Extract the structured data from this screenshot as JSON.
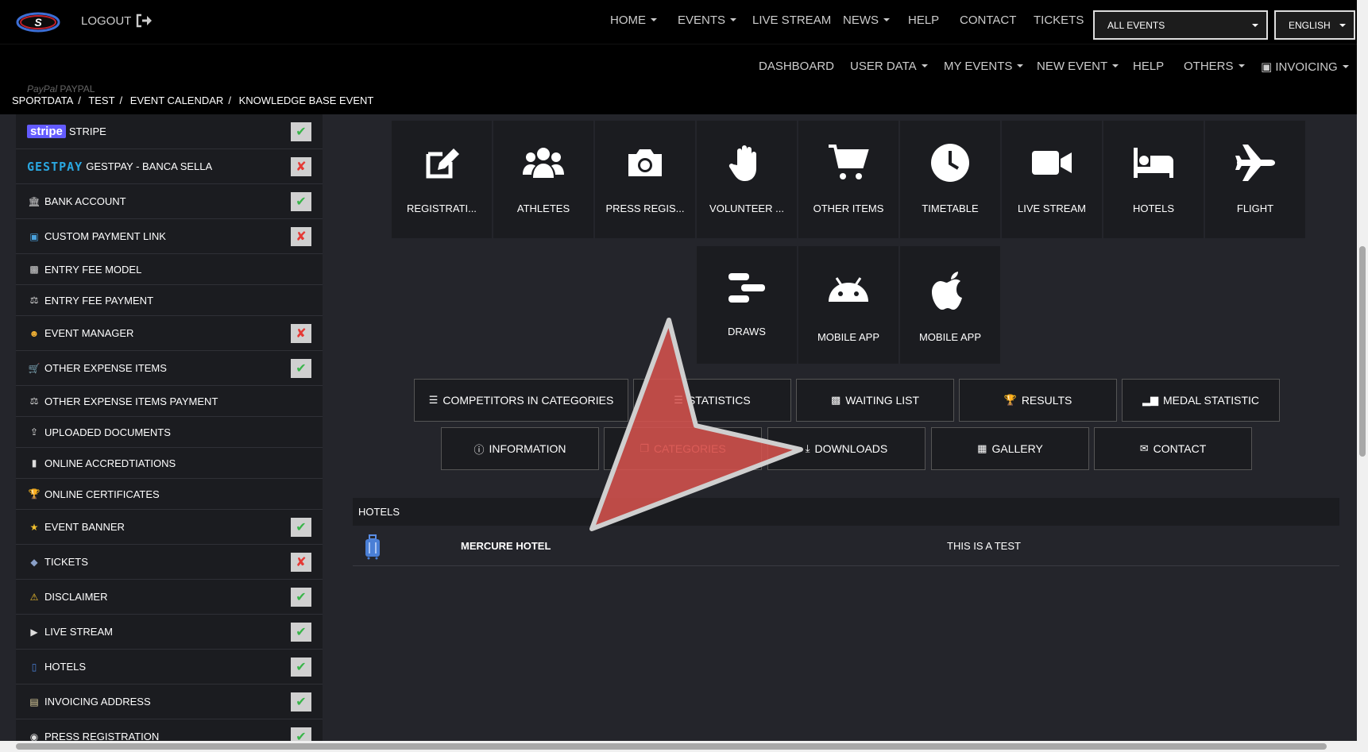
{
  "header": {
    "logout": "LOGOUT",
    "nav": [
      {
        "label": "HOME",
        "dropdown": true
      },
      {
        "label": "EVENTS",
        "dropdown": true
      },
      {
        "label": "LIVE STREAM",
        "dropdown": false
      },
      {
        "label": "NEWS",
        "dropdown": true
      },
      {
        "label": "HELP",
        "dropdown": false
      },
      {
        "label": "CONTACT",
        "dropdown": false
      },
      {
        "label": "TICKETS",
        "dropdown": false
      }
    ],
    "event_select": "ALL EVENTS",
    "language_select": "ENGLISH"
  },
  "subnav": [
    {
      "label": "DASHBOARD",
      "dropdown": false
    },
    {
      "label": "USER DATA",
      "dropdown": true
    },
    {
      "label": "MY EVENTS",
      "dropdown": true
    },
    {
      "label": "NEW EVENT",
      "dropdown": true
    },
    {
      "label": "HELP",
      "dropdown": false
    },
    {
      "label": "OTHERS",
      "dropdown": true
    },
    {
      "label": "INVOICING",
      "dropdown": true
    }
  ],
  "breadcrumb": [
    "SPORTDATA",
    "TEST",
    "EVENT CALENDAR",
    "KNOWLEDGE BASE EVENT"
  ],
  "ghost_row": {
    "logo": "PayPal",
    "label": "PAYPAL"
  },
  "sidebar": {
    "stripe_logo": "stripe",
    "gestpay_logo": "GESTPAY",
    "items": [
      {
        "label": "STRIPE",
        "status": "ok",
        "icon": "stripe-logo"
      },
      {
        "label": "GESTPAY - BANCA SELLA",
        "status": "no",
        "icon": "gestpay-logo"
      },
      {
        "label": "BANK ACCOUNT",
        "status": "ok",
        "icon": "bank-icon"
      },
      {
        "label": "CUSTOM PAYMENT LINK",
        "status": "no",
        "icon": "card-icon"
      },
      {
        "label": "ENTRY FEE MODEL",
        "status": "",
        "icon": "money-icon"
      },
      {
        "label": "ENTRY FEE PAYMENT",
        "status": "",
        "icon": "payment-icon"
      },
      {
        "label": "EVENT MANAGER",
        "status": "no",
        "icon": "user-icon"
      },
      {
        "label": "OTHER EXPENSE ITEMS",
        "status": "ok",
        "icon": "cart-icon"
      },
      {
        "label": "OTHER EXPENSE ITEMS PAYMENT",
        "status": "",
        "icon": "payment-icon"
      },
      {
        "label": "UPLOADED DOCUMENTS",
        "status": "",
        "icon": "upload-icon"
      },
      {
        "label": "ONLINE ACCREDTIATIONS",
        "status": "",
        "icon": "badge-icon"
      },
      {
        "label": "ONLINE CERTIFICATES",
        "status": "",
        "icon": "trophy-icon"
      },
      {
        "label": "EVENT BANNER",
        "status": "ok",
        "icon": "star-icon"
      },
      {
        "label": "TICKETS",
        "status": "no",
        "icon": "ticket-icon"
      },
      {
        "label": "DISCLAIMER",
        "status": "ok",
        "icon": "warning-icon"
      },
      {
        "label": "LIVE STREAM",
        "status": "ok",
        "icon": "video-icon"
      },
      {
        "label": "HOTELS",
        "status": "ok",
        "icon": "luggage-icon"
      },
      {
        "label": "INVOICING ADDRESS",
        "status": "ok",
        "icon": "invoice-icon"
      },
      {
        "label": "PRESS REGISTRATION",
        "status": "ok",
        "icon": "camera-icon"
      }
    ]
  },
  "tiles": [
    {
      "label": "REGISTRATI...",
      "icon": "edit-icon"
    },
    {
      "label": "ATHLETES",
      "icon": "users-icon"
    },
    {
      "label": "PRESS REGIS...",
      "icon": "camera-icon"
    },
    {
      "label": "VOLUNTEER ...",
      "icon": "hand-icon"
    },
    {
      "label": "OTHER ITEMS",
      "icon": "cart-icon"
    },
    {
      "label": "TIMETABLE",
      "icon": "clock-icon"
    },
    {
      "label": "LIVE STREAM",
      "icon": "video-icon"
    },
    {
      "label": "HOTELS",
      "icon": "bed-icon"
    },
    {
      "label": "FLIGHT",
      "icon": "plane-icon"
    },
    {
      "label": "DRAWS",
      "icon": "draws-icon"
    },
    {
      "label": "MOBILE APP",
      "icon": "android-icon"
    },
    {
      "label": "MOBILE APP",
      "icon": "apple-icon"
    }
  ],
  "buttons_row1": [
    {
      "label": "COMPETITORS IN CATEGORIES",
      "icon": "list-icon"
    },
    {
      "label": "STATISTICS",
      "icon": "list-icon"
    },
    {
      "label": "WAITING LIST",
      "icon": "clipboard-icon"
    },
    {
      "label": "RESULTS",
      "icon": "trophy-icon"
    },
    {
      "label": "MEDAL STATISTIC",
      "icon": "bar-chart-icon"
    }
  ],
  "buttons_row2": [
    {
      "label": "INFORMATION",
      "icon": "info-icon"
    },
    {
      "label": "CATEGORIES",
      "icon": "copy-icon"
    },
    {
      "label": "DOWNLOADS",
      "icon": "download-icon"
    },
    {
      "label": "GALLERY",
      "icon": "image-icon"
    },
    {
      "label": "CONTACT",
      "icon": "envelope-icon"
    }
  ],
  "hotels_section": {
    "title": "HOTELS",
    "rows": [
      {
        "name": "MERCURE HOTEL",
        "description": "THIS IS A TEST",
        "icon": "luggage-icon"
      }
    ]
  },
  "colors": {
    "ok": "#39b54a",
    "no": "#e53935",
    "arrow": "#d9534f",
    "background": "#24252b",
    "panel": "#1b1c20"
  }
}
